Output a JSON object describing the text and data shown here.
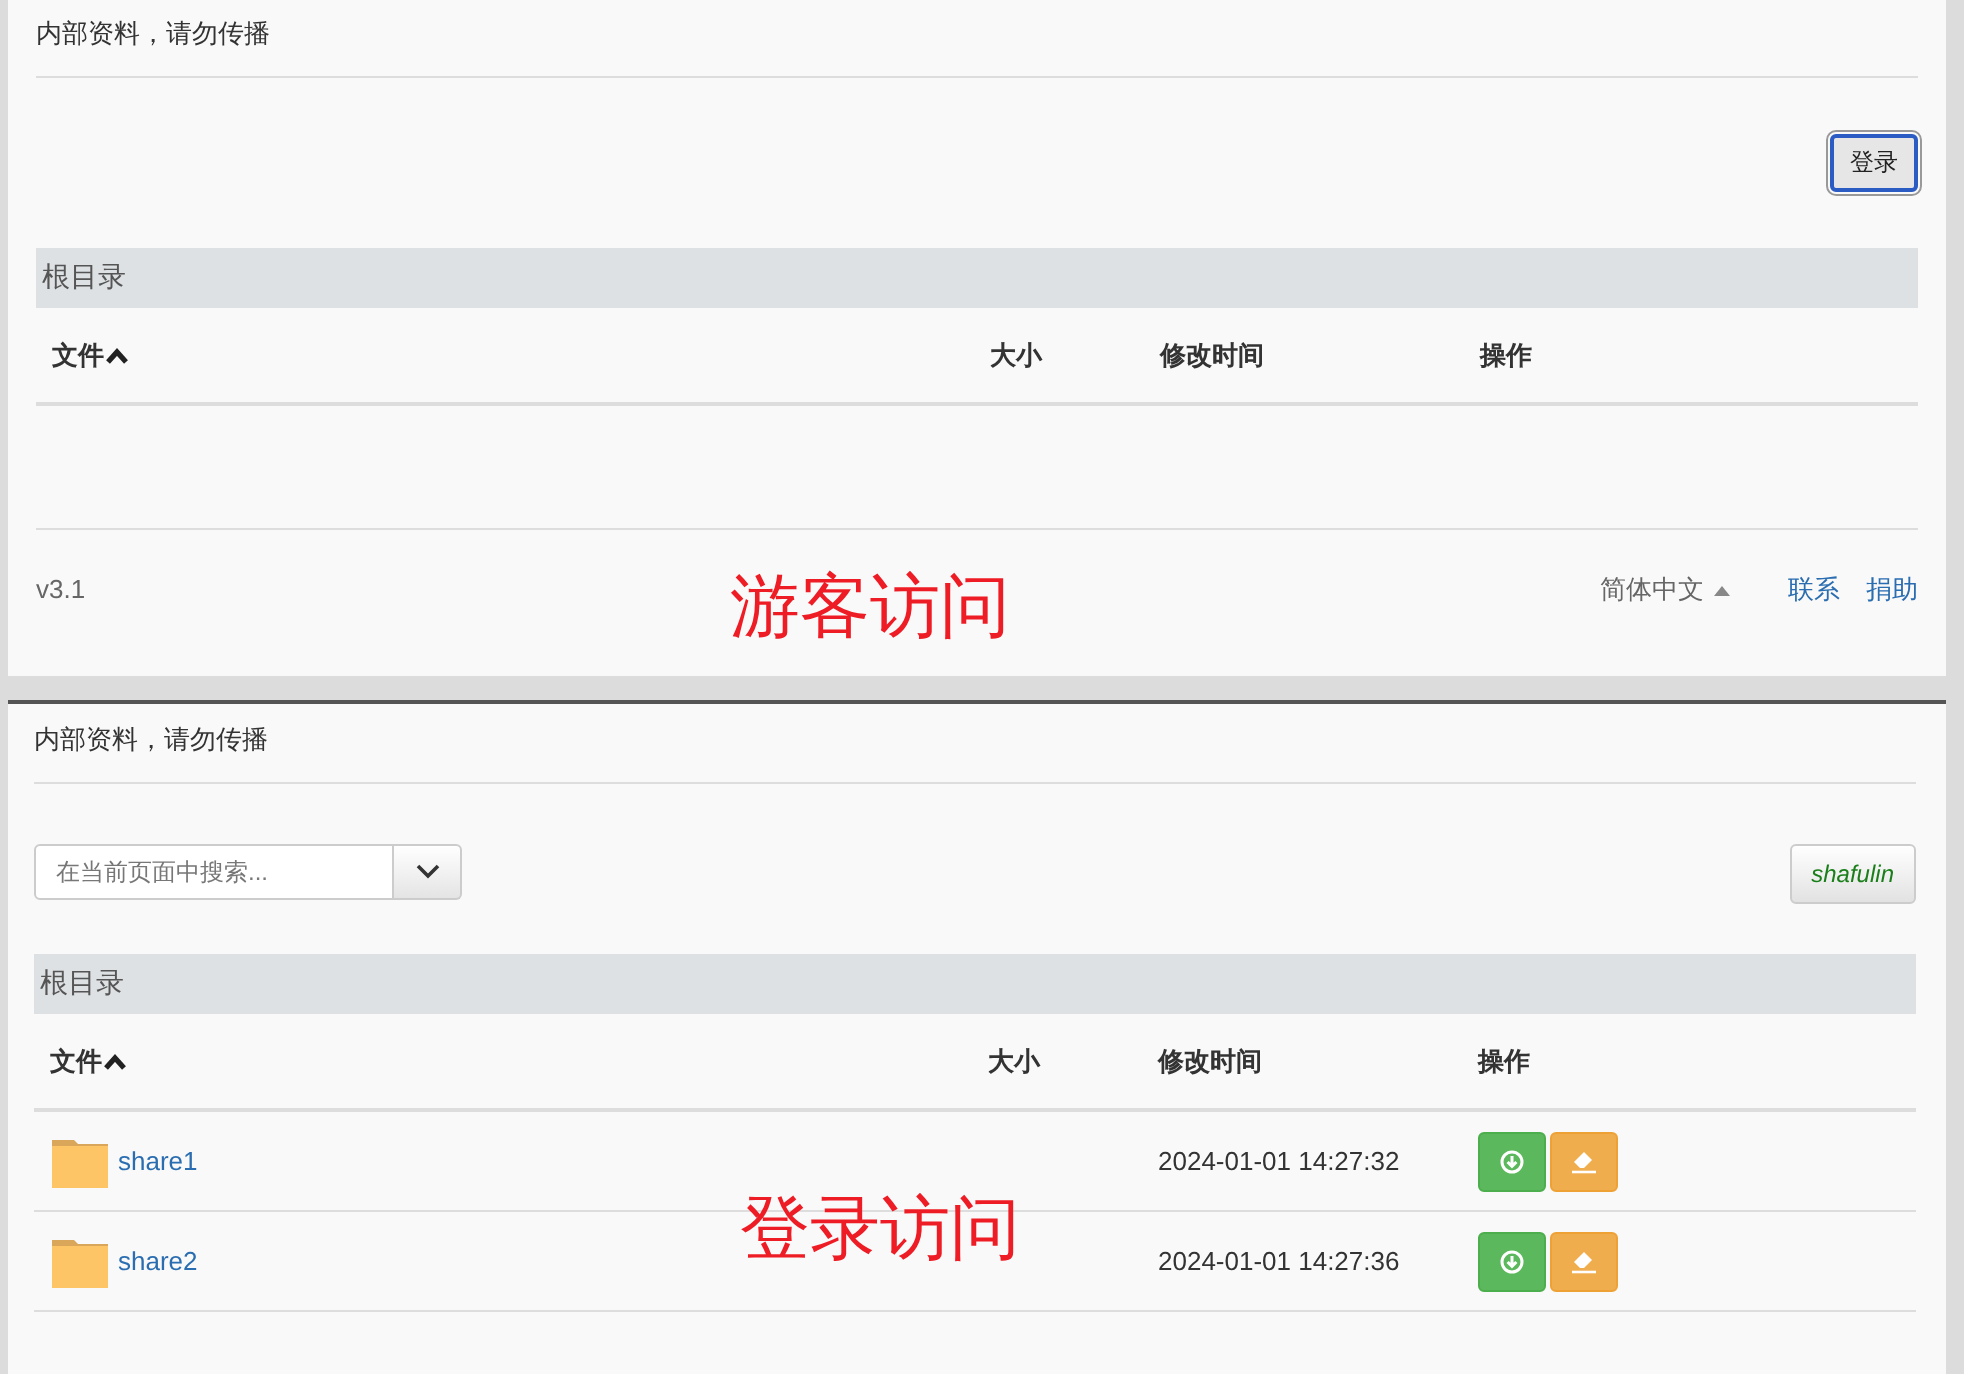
{
  "panels": [
    {
      "annotation": "游客访问",
      "notice": "内部资料，请勿传播",
      "login_button": "登录",
      "breadcrumb": "根目录",
      "columns": [
        {
          "label": "文件",
          "sorted": true
        },
        {
          "label": "大小",
          "sorted": false
        },
        {
          "label": "修改时间",
          "sorted": false
        },
        {
          "label": "操作",
          "sorted": false
        }
      ],
      "footer": {
        "version": "v3.1",
        "language": "简体中文",
        "links": [
          "联系",
          "捐助"
        ]
      }
    },
    {
      "annotation": "登录访问",
      "notice": "内部资料，请勿传播",
      "search": {
        "placeholder": "在当前页面中搜索..."
      },
      "user_button": "shafulin",
      "breadcrumb": "根目录",
      "columns": [
        {
          "label": "文件",
          "sorted": true
        },
        {
          "label": "大小",
          "sorted": false
        },
        {
          "label": "修改时间",
          "sorted": false
        },
        {
          "label": "操作",
          "sorted": false
        }
      ],
      "rows": [
        {
          "name": "share1",
          "modified": "2024-01-01 14:27:32"
        },
        {
          "name": "share2",
          "modified": "2024-01-01 14:27:36"
        }
      ]
    }
  ]
}
